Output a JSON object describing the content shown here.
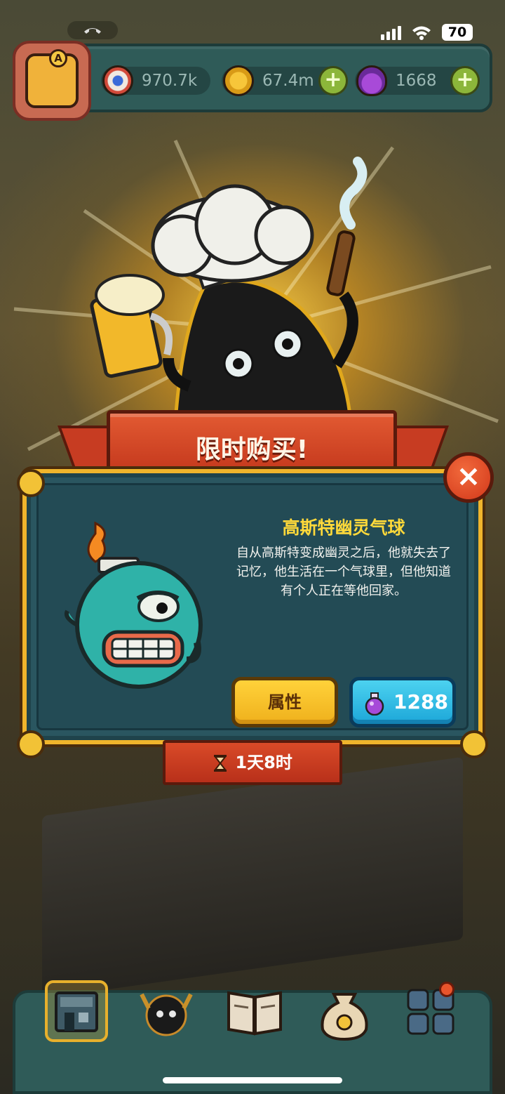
{
  "status_bar": {
    "call_pill": "",
    "battery": "70"
  },
  "resources": {
    "eyeballs": "970.7k",
    "coins": "67.4m",
    "potions": "1668",
    "plus_label": "+"
  },
  "popup": {
    "title": "限时购买!",
    "close_label": "×",
    "item_name": "高斯特幽灵气球",
    "item_description": "自从高斯特变成幽灵之后，他就失去了记忆，他生活在一个气球里，但他知道有个人正在等他回家。",
    "attributes_button": "属性",
    "price": "1288",
    "timer": "1天8时"
  },
  "bottom_nav": {
    "items": [
      "restaurant",
      "monsters",
      "book",
      "bag",
      "more"
    ],
    "active_index": 0
  },
  "colors": {
    "panel": "#2a5660",
    "gold_border": "#f0b52c",
    "ribbon": "#d84a28",
    "item_name": "#ffd93a",
    "buy_button": "#22b0dc",
    "attr_button": "#f5c02a"
  }
}
